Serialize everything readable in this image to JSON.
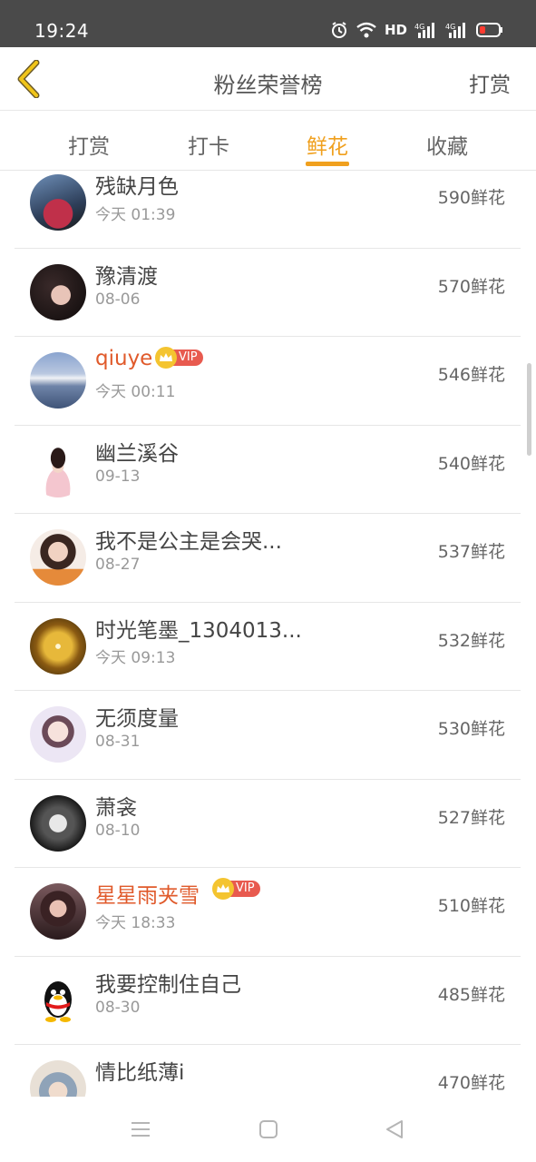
{
  "status_bar": {
    "time": "19:24",
    "network_label": "HD"
  },
  "nav": {
    "back_icon": "chevron-left-icon",
    "title": "粉丝荣誉榜",
    "action": "打赏"
  },
  "tabs": [
    {
      "label": "打赏",
      "active": false
    },
    {
      "label": "打卡",
      "active": false
    },
    {
      "label": "鲜花",
      "active": true
    },
    {
      "label": "收藏",
      "active": false
    }
  ],
  "accent_color": "#f0a01e",
  "vip_name_color": "#e05a2b",
  "vip_label": "VIP",
  "fans": [
    {
      "name": "残缺月色",
      "time": "今天 01:39",
      "flowers": "590鲜花",
      "vip": false
    },
    {
      "name": "豫清渡",
      "time": "08-06",
      "flowers": "570鲜花",
      "vip": false
    },
    {
      "name": "qiuye",
      "time": "今天 00:11",
      "flowers": "546鲜花",
      "vip": true
    },
    {
      "name": "幽兰溪谷",
      "time": "09-13",
      "flowers": "540鲜花",
      "vip": false
    },
    {
      "name": "我不是公主是会哭...",
      "time": "08-27",
      "flowers": "537鲜花",
      "vip": false
    },
    {
      "name": "时光笔墨_1304013...",
      "time": "今天 09:13",
      "flowers": "532鲜花",
      "vip": false
    },
    {
      "name": "无须度量",
      "time": "08-31",
      "flowers": "530鲜花",
      "vip": false
    },
    {
      "name": "萧衾",
      "time": "08-10",
      "flowers": "527鲜花",
      "vip": false
    },
    {
      "name": "星星雨夹雪",
      "time": "今天 18:33",
      "flowers": "510鲜花",
      "vip": true
    },
    {
      "name": "我要控制住自己",
      "time": "08-30",
      "flowers": "485鲜花",
      "vip": false
    },
    {
      "name": "情比纸薄i",
      "time": "",
      "flowers": "470鲜花",
      "vip": false
    }
  ],
  "bottom_nav": {
    "menu_icon": "menu-icon",
    "home_icon": "square-home-icon",
    "back_icon": "triangle-back-icon"
  }
}
